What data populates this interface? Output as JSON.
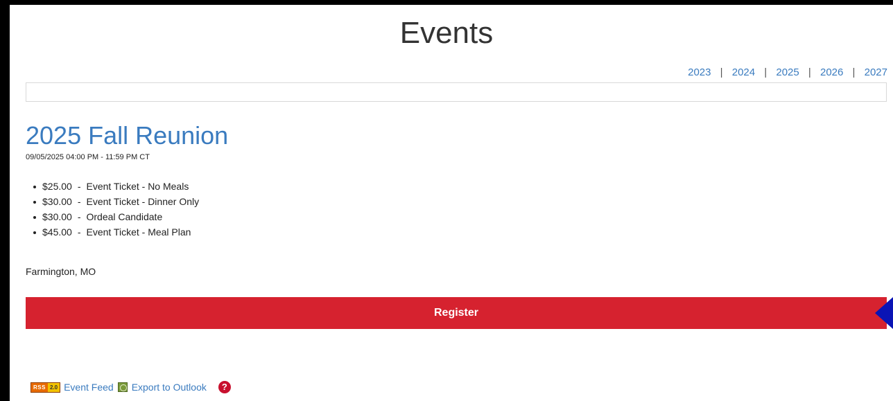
{
  "page": {
    "title": "Events"
  },
  "year_nav": {
    "years": [
      "2023",
      "2024",
      "2025",
      "2026",
      "2027"
    ],
    "separator": "|"
  },
  "event": {
    "title": "2025 Fall Reunion",
    "datetime": "09/05/2025 04:00 PM - 11:59 PM CT",
    "tickets": [
      {
        "price": "$25.00",
        "name": "Event Ticket - No Meals"
      },
      {
        "price": "$30.00",
        "name": "Event Ticket - Dinner Only"
      },
      {
        "price": "$30.00",
        "name": "Ordeal Candidate"
      },
      {
        "price": "$45.00",
        "name": "Event Ticket - Meal Plan"
      }
    ],
    "location": "Farmington, MO",
    "register_label": "Register"
  },
  "footer": {
    "rss_badge_left": "RSS",
    "rss_badge_right": "2.0",
    "event_feed_label": "Event Feed",
    "export_label": "Export to Outlook",
    "help_glyph": "?"
  },
  "colors": {
    "link": "#3a7bbf",
    "register_bg": "#d6222f",
    "pointer_arrow": "#0a14b5",
    "help_bg": "#c8102e"
  }
}
